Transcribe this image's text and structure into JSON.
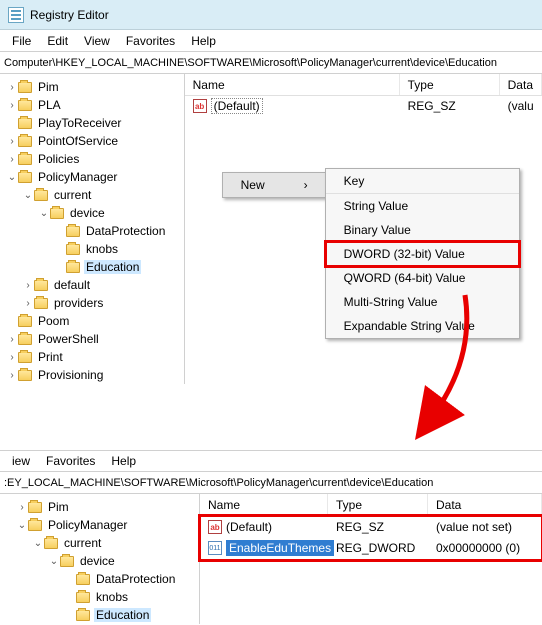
{
  "titlebar": {
    "title": "Registry Editor"
  },
  "menubar": {
    "file": "File",
    "edit": "Edit",
    "view": "View",
    "favorites": "Favorites",
    "help": "Help"
  },
  "address": "Computer\\HKEY_LOCAL_MACHINE\\SOFTWARE\\Microsoft\\PolicyManager\\current\\device\\Education",
  "tree": {
    "pim": "Pim",
    "pla": "PLA",
    "ptr": "PlayToReceiver",
    "pos": "PointOfService",
    "pol": "Policies",
    "pmgr": "PolicyManager",
    "cur": "current",
    "dev": "device",
    "dp": "DataProtection",
    "knobs": "knobs",
    "edu": "Education",
    "default": "default",
    "prov": "providers",
    "poom": "Poom",
    "ps": "PowerShell",
    "print": "Print",
    "prv": "Provisioning"
  },
  "list": {
    "headers": {
      "name": "Name",
      "type": "Type",
      "data": "Data"
    },
    "default_label": "(Default)",
    "default_type": "REG_SZ",
    "default_data": "(valu"
  },
  "ctx": {
    "new": "New",
    "key": "Key",
    "string": "String Value",
    "binary": "Binary Value",
    "dword": "DWORD (32-bit) Value",
    "qword": "QWORD (64-bit) Value",
    "multi": "Multi-String Value",
    "expand": "Expandable String Value"
  },
  "menubar2": {
    "view": "iew",
    "favorites": "Favorites",
    "help": "Help"
  },
  "address2": ":EY_LOCAL_MACHINE\\SOFTWARE\\Microsoft\\PolicyManager\\current\\device\\Education",
  "tree2": {
    "pim": "Pim",
    "pmgr": "PolicyManager",
    "cur": "current",
    "dev": "device",
    "dp": "DataProtection",
    "knobs": "knobs",
    "edu": "Education"
  },
  "list2": {
    "headers": {
      "name": "Name",
      "type": "Type",
      "data": "Data"
    },
    "r1": {
      "name": "(Default)",
      "type": "REG_SZ",
      "data": "(value not set)"
    },
    "r2": {
      "name": "EnableEduThemes",
      "type": "REG_DWORD",
      "data": "0x00000000 (0)"
    }
  }
}
